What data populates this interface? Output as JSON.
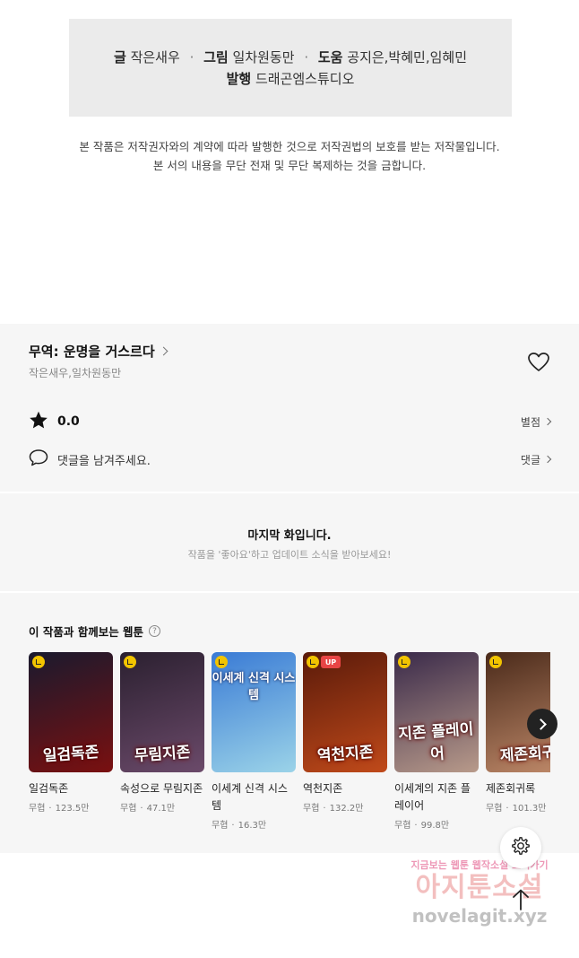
{
  "credits": {
    "line1": [
      {
        "role": "글",
        "name": "작은새우"
      },
      {
        "role": "그림",
        "name": "일차원동만"
      },
      {
        "role": "도움",
        "name": "공지은,박혜민,임혜민"
      }
    ],
    "line2": {
      "role": "발행",
      "name": "드래곤엠스튜디오"
    },
    "separator": "·"
  },
  "copyright": {
    "line1": "본 작품은 저작권자와의 계약에 따라 발행한 것으로 저작권법의 보호를 받는 저작물입니다.",
    "line2": "본 서의 내용을 무단 전재 및 무단 복제하는 것을 금합니다."
  },
  "work": {
    "title": "무역: 운명을 거스르다",
    "authors": "작은새우,일차원동만",
    "rating": "0.0",
    "rating_link": "별점",
    "comment_prompt": "댓글을 남겨주세요.",
    "comment_link": "댓글"
  },
  "last_episode": {
    "title": "마지막 화입니다.",
    "subtitle": "작품을 '좋아요'하고 업데이트 소식을 받아보세요!"
  },
  "recommendations": {
    "heading": "이 작품과 함께보는 웹툰",
    "help_icon": "?",
    "items": [
      {
        "title": "일검독존",
        "genre": "무협",
        "views": "123.5만",
        "cover_text": "일검독존",
        "cover_top": "",
        "up": false,
        "colors": [
          "#1a1a2e",
          "#7a1010"
        ]
      },
      {
        "title": "속성으로 무림지존",
        "genre": "무협",
        "views": "47.1만",
        "cover_text": "무림지존",
        "cover_top": "",
        "up": false,
        "colors": [
          "#2b2030",
          "#6b4a6a"
        ]
      },
      {
        "title": "이세계 신격 시스템",
        "genre": "무협",
        "views": "16.3만",
        "cover_text": "",
        "cover_top": "이세계 신격 시스템",
        "up": false,
        "colors": [
          "#3a7bd5",
          "#9bd3e8"
        ]
      },
      {
        "title": "역천지존",
        "genre": "무협",
        "views": "132.2만",
        "cover_text": "역천지존",
        "cover_top": "",
        "up": true,
        "up_label": "UP",
        "colors": [
          "#5a1a0a",
          "#c04a1a"
        ]
      },
      {
        "title": "이세계의 지존 플레이어",
        "genre": "무협",
        "views": "99.8만",
        "cover_text": "지존 플레이어",
        "cover_top": "",
        "up": false,
        "colors": [
          "#3a2a4a",
          "#b89a8a"
        ]
      },
      {
        "title": "제존회귀록",
        "genre": "무협",
        "views": "101.3만",
        "cover_text": "제존회귀",
        "cover_top": "",
        "up": false,
        "colors": [
          "#4a2a1a",
          "#c08a6a"
        ]
      }
    ]
  },
  "watermark": {
    "line1": "지금보는 웹툰 웹작소설 보러가기",
    "line2": "아지툰소설",
    "line3": "novelagit.xyz"
  },
  "icons": {
    "heart": "heart-icon",
    "star": "star-icon",
    "comment": "speech-bubble-icon",
    "settings": "gear-icon",
    "scroll_top": "arrow-up-icon",
    "next": "chevron-right-icon"
  }
}
